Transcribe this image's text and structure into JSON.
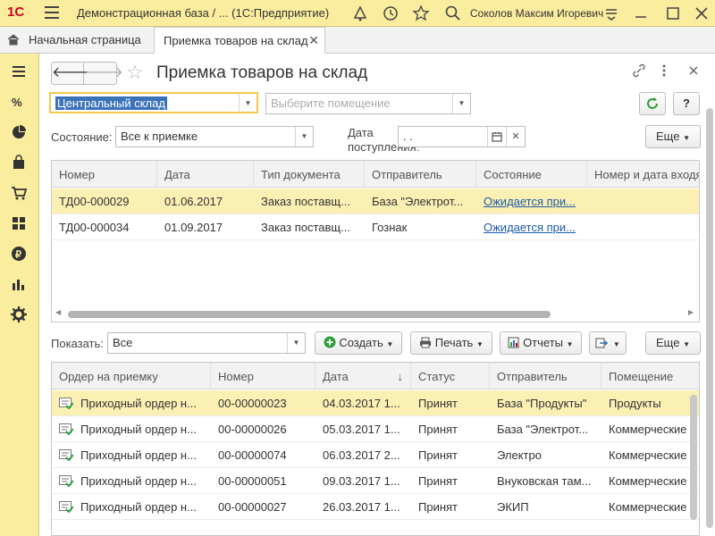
{
  "app": {
    "logo": "1С",
    "title": "Демонстрационная база / ...  (1С:Предприятие)",
    "user": "Соколов Максим Игоревич"
  },
  "tabs": {
    "home": "Начальная страница",
    "active": "Приемка товаров на склад",
    "close": "✕"
  },
  "form": {
    "title": "Приемка товаров на склад",
    "warehouse": "Центральный склад",
    "room_placeholder": "Выберите помещение",
    "state_label": "Состояние:",
    "state_value": "Все к приемке",
    "date_label_1": "Дата",
    "date_label_2": "поступления:",
    "date_value": " .  .",
    "more_label": "Еще",
    "refresh_icon": "refresh-icon",
    "help_label": "?"
  },
  "docs_table": {
    "columns": [
      "Номер",
      "Дата",
      "Тип документа",
      "Отправитель",
      "Состояние",
      "Номер и дата входя"
    ],
    "rows": [
      {
        "number": "ТД00-000029",
        "date": "01.06.2017",
        "type": "Заказ поставщ...",
        "sender": "База \"Электрот...",
        "state": "Ожидается при..."
      },
      {
        "number": "ТД00-000034",
        "date": "01.09.2017",
        "type": "Заказ поставщ...",
        "sender": "Гознак",
        "state": "Ожидается при..."
      }
    ]
  },
  "lower_toolbar": {
    "show_label": "Показать:",
    "show_value": "Все",
    "create": "Создать",
    "print": "Печать",
    "reports": "Отчеты",
    "more": "Еще"
  },
  "orders_table": {
    "columns": [
      "Ордер на приемку",
      "Номер",
      "Дата",
      "Статус",
      "Отправитель",
      "Помещение"
    ],
    "sort_indicator": "↓",
    "rows": [
      {
        "order": "Приходный ордер н...",
        "number": "00-00000023",
        "date": "04.03.2017 1...",
        "status": "Принят",
        "sender": "База \"Продукты\"",
        "room": "Продукты"
      },
      {
        "order": "Приходный ордер н...",
        "number": "00-00000026",
        "date": "05.03.2017 1...",
        "status": "Принят",
        "sender": "База \"Электрот...",
        "room": "Коммерческие ..."
      },
      {
        "order": "Приходный ордер н...",
        "number": "00-00000074",
        "date": "06.03.2017 2...",
        "status": "Принят",
        "sender": "Электро",
        "room": "Коммерческие ..."
      },
      {
        "order": "Приходный ордер н...",
        "number": "00-00000051",
        "date": "09.03.2017 1...",
        "status": "Принят",
        "sender": "Внуковская там...",
        "room": "Коммерческие ..."
      },
      {
        "order": "Приходный ордер н...",
        "number": "00-00000027",
        "date": "26.03.2017 1...",
        "status": "Принят",
        "sender": "ЭКИП",
        "room": "Коммерческие ..."
      }
    ]
  },
  "colors": {
    "panel": "#fbed9e",
    "selected_row": "#fbf0b4",
    "accent": "#3b73b9",
    "link": "#1c5aa6"
  }
}
